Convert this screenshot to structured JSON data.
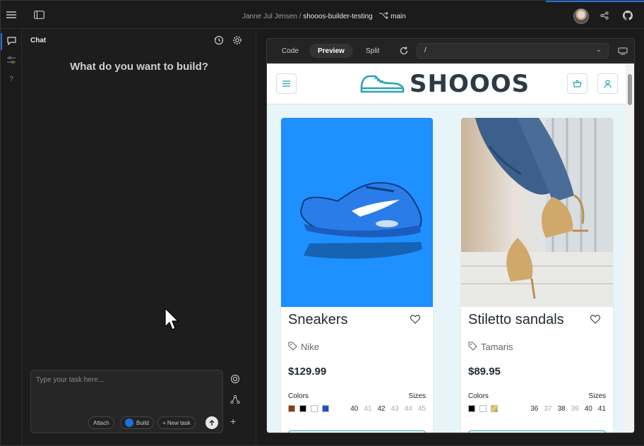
{
  "header": {
    "user_name": "Janne Jul Jensen",
    "separator": "/",
    "project": "shooos-builder-testing",
    "branch": "main"
  },
  "chat": {
    "title": "Chat",
    "question": "What do you want to build?",
    "input_placeholder": "Type your task here...",
    "attach_label": "Attach",
    "build_label": "Build",
    "new_task_label": "+ New task"
  },
  "preview": {
    "tabs": [
      "Code",
      "Preview",
      "Split"
    ],
    "active_tab": "Preview",
    "url": "/"
  },
  "site": {
    "logo": "SHOOOS",
    "products": [
      {
        "name": "Sneakers",
        "brand": "Nike",
        "price": "$129.99",
        "colors_label": "Colors",
        "sizes_label": "Sizes",
        "colors": [
          "#8a3a14",
          "#000000",
          "#ffffff",
          "#1f4fd0"
        ],
        "sizes": [
          {
            "size": "40",
            "available": true
          },
          {
            "size": "41",
            "available": false
          },
          {
            "size": "42",
            "available": true
          },
          {
            "size": "43",
            "available": false
          },
          {
            "size": "44",
            "available": false
          },
          {
            "size": "45",
            "available": false
          }
        ]
      },
      {
        "name": "Stiletto sandals",
        "brand": "Tamaris",
        "price": "$89.95",
        "colors_label": "Colors",
        "sizes_label": "Sizes",
        "colors": [
          "#000000",
          "#ffffff",
          "#c9a24a"
        ],
        "sizes": [
          {
            "size": "36",
            "available": true
          },
          {
            "size": "37",
            "available": false
          },
          {
            "size": "38",
            "available": true
          },
          {
            "size": "39",
            "available": false
          },
          {
            "size": "40",
            "available": true
          },
          {
            "size": "41",
            "available": true
          }
        ]
      }
    ]
  },
  "colors": {
    "accent": "#2b6fd6",
    "brand_teal": "#2aa3b5",
    "sneaker_bg": "#1e90ff"
  }
}
